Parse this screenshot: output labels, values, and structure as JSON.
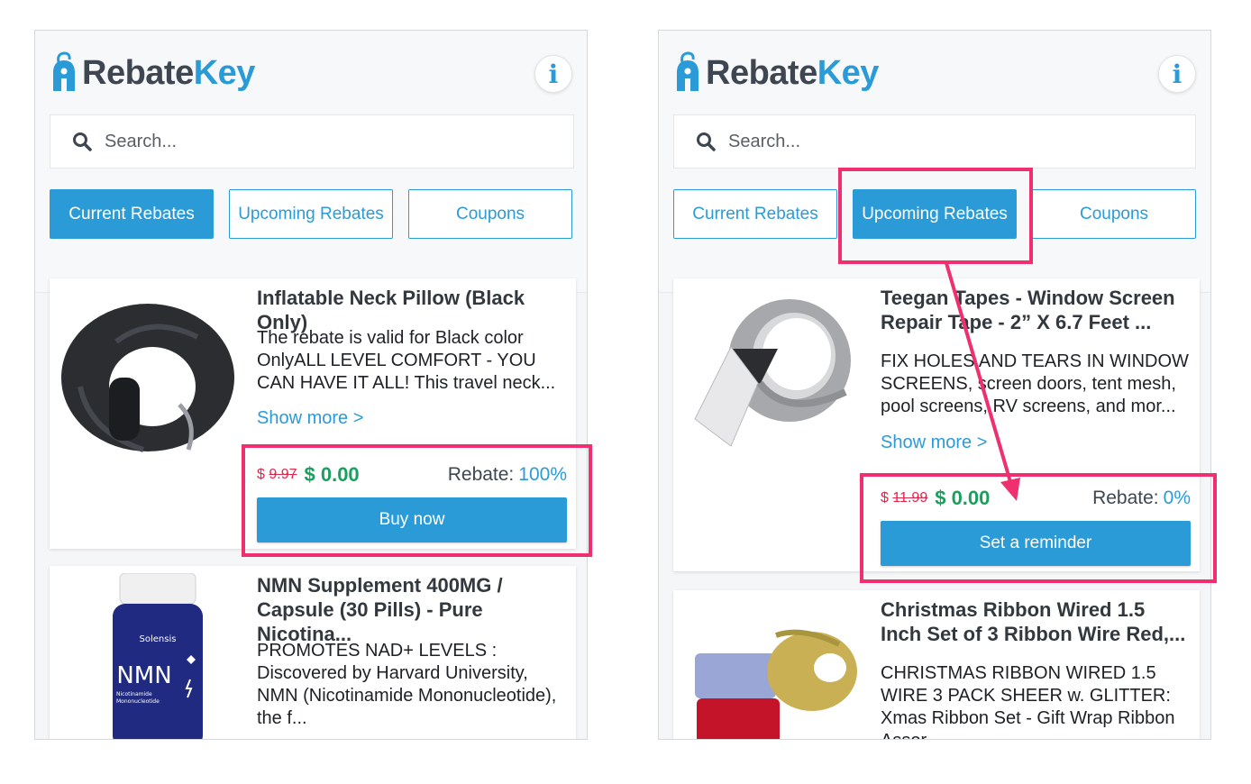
{
  "brand": {
    "part1": "Rebate",
    "part2": "Key",
    "color_primary": "#2a9bd6",
    "color_dark": "#3d4651"
  },
  "info_icon": "i",
  "search": {
    "placeholder": "Search...",
    "icon": "search-icon"
  },
  "tabs": [
    "Current Rebates",
    "Upcoming Rebates",
    "Coupons"
  ],
  "left_panel": {
    "active_tab": 0,
    "cards": [
      {
        "title": "Inflatable Neck Pillow (Black Only)",
        "description": "The rebate is valid for Black color OnlyALL LEVEL COMFORT - YOU CAN HAVE IT ALL! This travel neck...",
        "more": "Show more >",
        "currency": "$",
        "old_price": "9.97",
        "new_price": "$ 0.00",
        "rebate_label": "Rebate:",
        "rebate_value": "100%",
        "button": "Buy now"
      },
      {
        "title": "NMN Supplement 400MG / Capsule (30 Pills) - Pure Nicotina...",
        "description": "PROMOTES NAD+ LEVELS : Discovered by Harvard University, NMN (Nicotinamide Mononucleotide), the f...",
        "image_brand": "Solensis",
        "image_label": "NMN",
        "image_sub1": "Nicotinamide",
        "image_sub2": "Mononucleotide"
      }
    ]
  },
  "right_panel": {
    "active_tab": 1,
    "cards": [
      {
        "title": "Teegan Tapes - Window Screen Repair Tape - 2” X 6.7 Feet ...",
        "description": "FIX HOLES AND TEARS IN WINDOW SCREENS, screen doors, tent mesh, pool screens, RV screens, and mor...",
        "more": "Show more >",
        "currency": "$",
        "old_price": "11.99",
        "new_price": "$ 0.00",
        "rebate_label": "Rebate:",
        "rebate_value": "0%",
        "button": "Set a reminder"
      },
      {
        "title": "Christmas Ribbon Wired 1.5 Inch Set of 3 Ribbon Wire Red,...",
        "description": "CHRISTMAS RIBBON WIRED 1.5 WIRE 3 PACK SHEER w. GLITTER: Xmas Ribbon Set - Gift Wrap Ribbon Assor..."
      }
    ]
  },
  "highlight_color": "#ef2f6e"
}
